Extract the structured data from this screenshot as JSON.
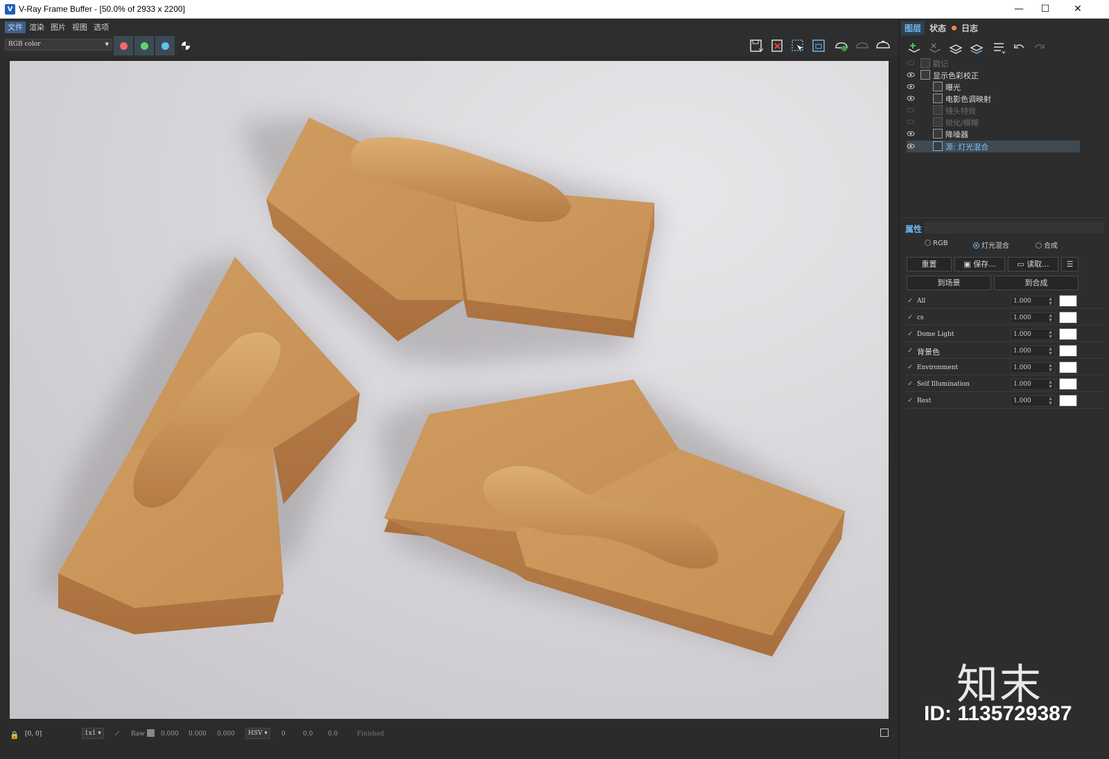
{
  "window": {
    "title": "V-Ray Frame Buffer - [50.0% of 2933 x 2200]",
    "minimize": "—",
    "maximize": "☐",
    "close": "✕"
  },
  "menu": [
    "文件",
    "渲染",
    "图片",
    "视图",
    "选项"
  ],
  "toolbar": {
    "channel": "RGB color",
    "color_buttons": [
      "#f26b6b",
      "#5fd46f",
      "#5fc3f0"
    ]
  },
  "status": {
    "coords": "[0, 0]",
    "zoom": "1x1",
    "mode": "Raw",
    "vals": [
      "0.000",
      "0.000",
      "0.000"
    ],
    "color_space": "HSV",
    "hsv": [
      "0",
      "0.0",
      "0.0"
    ],
    "state": "Finished"
  },
  "right_tabs": [
    "图层",
    "状态",
    "日志"
  ],
  "layers": [
    {
      "label": "戳记",
      "dim": true
    },
    {
      "label": "显示色彩校正",
      "dim": false
    },
    {
      "label": "曝光",
      "dim": false
    },
    {
      "label": "电影色调映射",
      "dim": false
    },
    {
      "label": "镜头特效",
      "dim": true
    },
    {
      "label": "锐化/模糊",
      "dim": true
    },
    {
      "label": "降噪器",
      "dim": false
    },
    {
      "label": "源: 灯光混合",
      "dim": false,
      "selected": true
    }
  ],
  "properties": {
    "title": "属性",
    "modes": [
      "RGB",
      "灯光混合",
      "合成"
    ],
    "selected_mode": "灯光混合",
    "buttons": {
      "reset": "重置",
      "save": "保存...",
      "load": "读取...",
      "to_scene": "到场景",
      "to_comp": "到合成"
    },
    "light_mix": [
      {
        "name": "All",
        "value": "1.000"
      },
      {
        "name": "cs",
        "value": "1.000"
      },
      {
        "name": "Dome Light",
        "value": "1.000"
      },
      {
        "name": "背景色",
        "value": "1.000"
      },
      {
        "name": "Environment",
        "value": "1.000"
      },
      {
        "name": "Self Illumination",
        "value": "1.000"
      },
      {
        "name": "Rest",
        "value": "1.000"
      }
    ]
  },
  "watermark": {
    "logo": "知末",
    "id": "ID: 1135729387"
  }
}
